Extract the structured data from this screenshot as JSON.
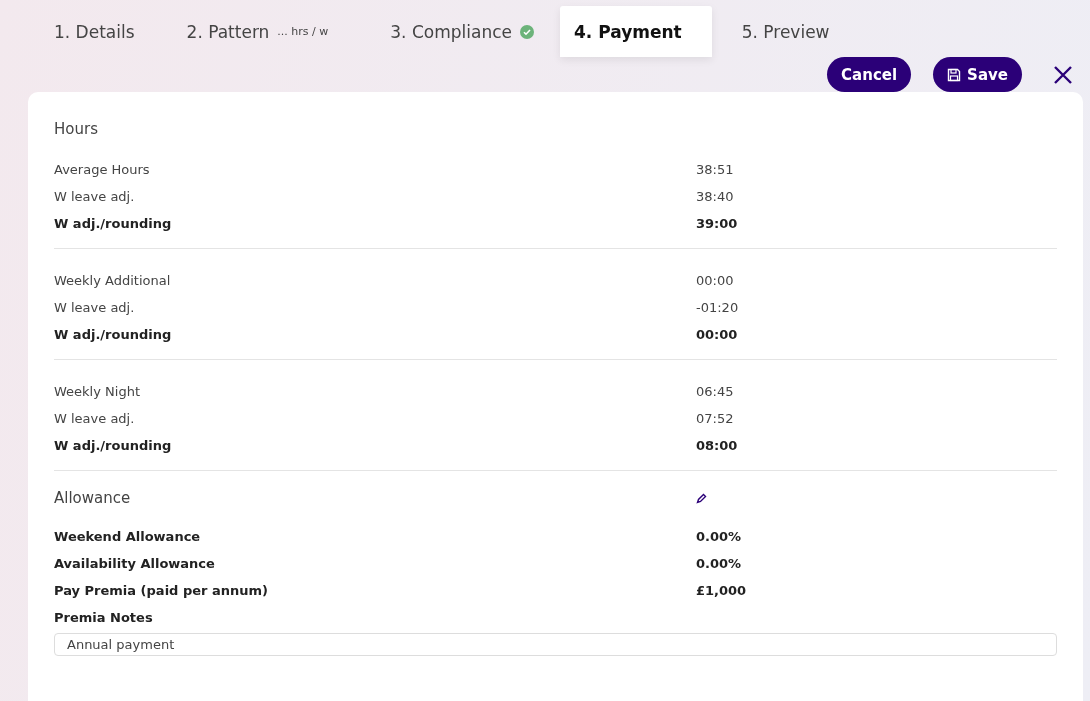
{
  "tabs": [
    {
      "label": "1. Details",
      "selected": false
    },
    {
      "label": "2. Pattern",
      "hint": "... hrs / w",
      "selected": false
    },
    {
      "label": "3. Compliance",
      "complete": true,
      "selected": false
    },
    {
      "label": "4. Payment",
      "selected": true
    },
    {
      "label": "5. Preview",
      "selected": false
    }
  ],
  "actions": {
    "cancel": "Cancel",
    "save": "Save"
  },
  "hours": {
    "title": "Hours",
    "groups": [
      {
        "rows": [
          {
            "label": "Average Hours",
            "value": "38:51",
            "bold": false
          },
          {
            "label": "W leave adj.",
            "value": "38:40",
            "bold": false
          },
          {
            "label": "W adj./rounding",
            "value": "39:00",
            "bold": true
          }
        ]
      },
      {
        "rows": [
          {
            "label": "Weekly Additional",
            "value": "00:00",
            "bold": false
          },
          {
            "label": "W leave adj.",
            "value": "-01:20",
            "bold": false
          },
          {
            "label": "W adj./rounding",
            "value": "00:00",
            "bold": true
          }
        ]
      },
      {
        "rows": [
          {
            "label": "Weekly Night",
            "value": "06:45",
            "bold": false
          },
          {
            "label": "W leave adj.",
            "value": "07:52",
            "bold": false
          },
          {
            "label": "W adj./rounding",
            "value": "08:00",
            "bold": true
          }
        ]
      }
    ]
  },
  "allowance": {
    "title": "Allowance",
    "rows": [
      {
        "label": "Weekend Allowance",
        "value": "0.00%",
        "bold": true
      },
      {
        "label": "Availability Allowance",
        "value": "0.00%",
        "bold": true
      },
      {
        "label": "Pay Premia (paid per annum)",
        "value": "£1,000",
        "bold": true
      }
    ],
    "notes_label": "Premia Notes",
    "notes_value": "Annual payment"
  }
}
